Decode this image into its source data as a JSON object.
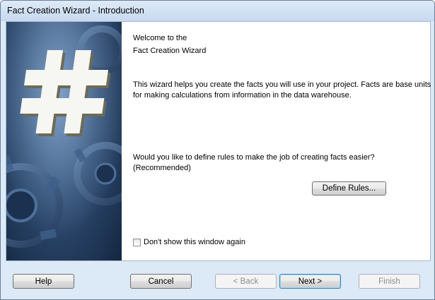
{
  "window": {
    "title": "Fact Creation Wizard - Introduction"
  },
  "side_image": {
    "icon": "hash-gear-graphic"
  },
  "content": {
    "welcome_line1": "Welcome to the",
    "welcome_line2": "Fact Creation Wizard",
    "description_line1": "This wizard helps you create the facts you will use in your project. Facts are base units",
    "description_line2": "for making calculations from information in the data warehouse.",
    "question_line1": "Would you like to define rules to make the job of creating facts easier?",
    "question_line2": "(Recommended)",
    "define_rules_label": "Define Rules...",
    "dont_show_label": "Don't show this window again",
    "dont_show_checked": false
  },
  "footer": {
    "help_label": "Help",
    "cancel_label": "Cancel",
    "back_label": "< Back",
    "back_enabled": false,
    "next_label": "Next >",
    "finish_label": "Finish",
    "finish_enabled": false
  },
  "colors": {
    "titlebar": "#d3e2f4",
    "frame": "#dce9f7",
    "default_button_border": "#3c7fb1"
  }
}
